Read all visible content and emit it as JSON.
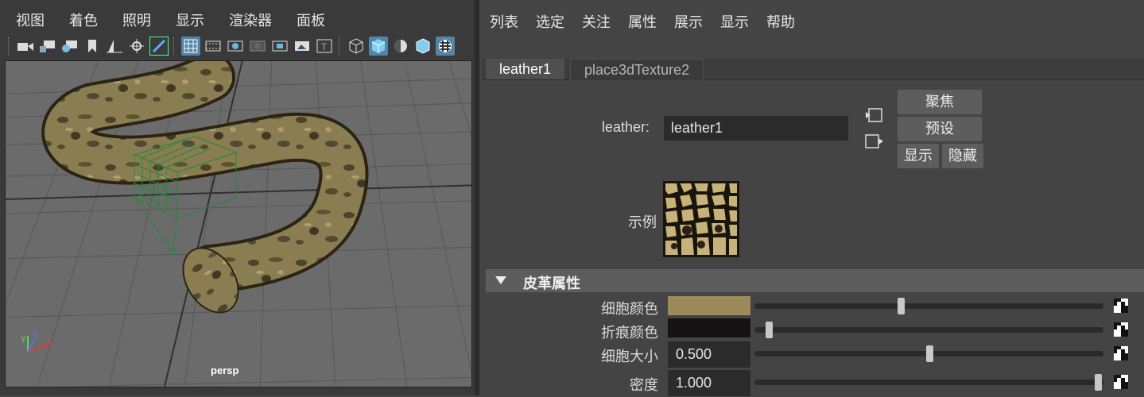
{
  "viewport": {
    "menu": [
      "视图",
      "着色",
      "照明",
      "显示",
      "渲染器",
      "面板"
    ],
    "camera_label": "persp",
    "axis_labels": {
      "x": "x",
      "y": "y",
      "z": "z"
    }
  },
  "attribute_editor": {
    "menu": [
      "列表",
      "选定",
      "关注",
      "属性",
      "展示",
      "显示",
      "帮助"
    ],
    "tabs": [
      "leather1",
      "place3dTexture2"
    ],
    "active_tab": "leather1",
    "node_label": "leather:",
    "node_name": "leather1",
    "buttons": {
      "focus": "聚焦",
      "presets": "预设",
      "show": "显示",
      "hide": "隐藏"
    },
    "sample_label": "示例",
    "section_title": "皮革属性",
    "attributes": [
      {
        "label": "细胞颜色",
        "type": "color",
        "color": "#9c8b58",
        "slider": 0.42
      },
      {
        "label": "折痕颜色",
        "type": "color",
        "color": "#161211",
        "slider": 0.04
      },
      {
        "label": "细胞大小",
        "type": "number",
        "value": "0.500",
        "slider": 0.5
      },
      {
        "label": "密度",
        "type": "number",
        "value": "1.000",
        "slider": 0.985
      }
    ]
  },
  "colors": {
    "accent_blue": "#5285a6",
    "panel_bg": "#444444",
    "field_bg": "#2b2b2b"
  }
}
